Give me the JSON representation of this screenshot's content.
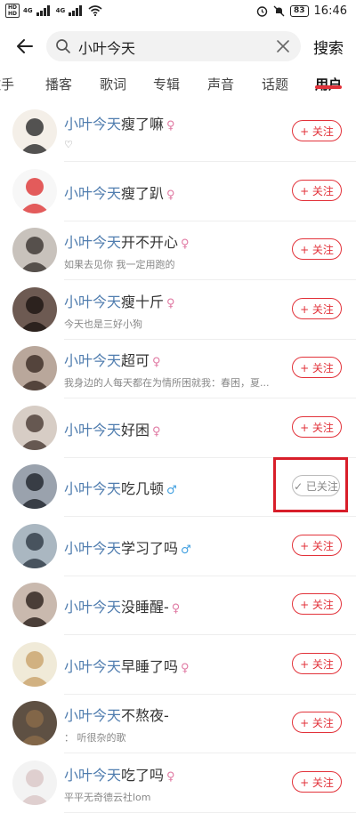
{
  "status_bar": {
    "left_tags": [
      "HD",
      "HD"
    ],
    "net_tags": [
      "4G",
      "4G"
    ],
    "battery": "83",
    "time": "16:46"
  },
  "search": {
    "query": "小叶今天",
    "search_label": "搜索"
  },
  "tabs": [
    {
      "label": "歌手"
    },
    {
      "label": "播客"
    },
    {
      "label": "歌词"
    },
    {
      "label": "专辑"
    },
    {
      "label": "声音"
    },
    {
      "label": "话题"
    },
    {
      "label": "用户",
      "active": true
    }
  ],
  "keyword": "小叶今天",
  "users": [
    {
      "name_rest": "瘦了嘛",
      "gender": "female",
      "desc": "♡",
      "followed": false
    },
    {
      "name_rest": "瘦了趴",
      "gender": "female",
      "desc": "",
      "followed": false
    },
    {
      "name_rest": "开不开心",
      "gender": "female",
      "desc": "如果去见你 我一定用跑的",
      "followed": false
    },
    {
      "name_rest": "瘦十斤",
      "gender": "female",
      "desc": "今天也是三好小狗",
      "followed": false
    },
    {
      "name_rest": "超可",
      "gender": "female",
      "desc": "我身边的人每天都在为情所困就我：春困，夏...",
      "followed": false
    },
    {
      "name_rest": "好困",
      "gender": "female",
      "desc": "",
      "followed": false
    },
    {
      "name_rest": "吃几顿",
      "gender": "male",
      "desc": "",
      "followed": true
    },
    {
      "name_rest": "学习了吗",
      "gender": "male",
      "desc": "",
      "followed": false
    },
    {
      "name_rest": "没睡醒-",
      "gender": "female",
      "desc": "",
      "followed": false
    },
    {
      "name_rest": "早睡了吗",
      "gender": "female",
      "desc": "",
      "followed": false
    },
    {
      "name_rest": "不熬夜-",
      "gender": "",
      "desc": "：  听很杂的歌",
      "followed": false
    },
    {
      "name_rest": "吃了吗",
      "gender": "female",
      "desc": "平平无奇德云社lom",
      "followed": false
    }
  ],
  "follow_label": "+ 关注",
  "followed_label": "✓ 已关注",
  "gender_symbols": {
    "female": "♀",
    "male": "♂"
  },
  "colors": {
    "accent": "#e2323a",
    "keyword": "#507daf",
    "female": "#e07aa3",
    "male": "#3f9fe0"
  }
}
